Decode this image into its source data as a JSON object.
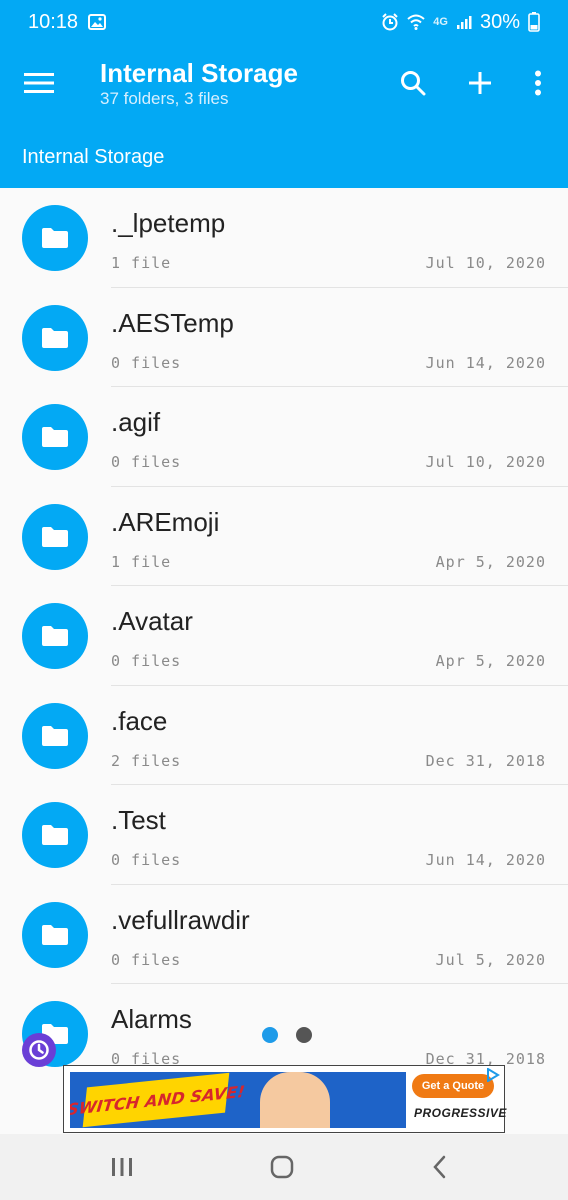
{
  "status_bar": {
    "time": "10:18",
    "network": "4G",
    "battery": "30%",
    "icons": [
      "image-icon",
      "alarm-icon",
      "wifi-icon",
      "signal-icon",
      "battery-icon"
    ]
  },
  "app_bar": {
    "title": "Internal Storage",
    "subtitle": "37 folders, 3 files",
    "actions": [
      "search-icon",
      "add-icon",
      "more-icon"
    ]
  },
  "breadcrumb": {
    "label": "Internal Storage"
  },
  "folders": [
    {
      "name": "._lpetemp",
      "count": "1 file",
      "date": "Jul 10, 2020"
    },
    {
      "name": ".AESTemp",
      "count": "0 files",
      "date": "Jun 14, 2020"
    },
    {
      "name": ".agif",
      "count": "0 files",
      "date": "Jul 10, 2020"
    },
    {
      "name": ".AREmoji",
      "count": "1 file",
      "date": "Apr 5, 2020"
    },
    {
      "name": ".Avatar",
      "count": "0 files",
      "date": "Apr 5, 2020"
    },
    {
      "name": ".face",
      "count": "2 files",
      "date": "Dec 31, 2018"
    },
    {
      "name": ".Test",
      "count": "0 files",
      "date": "Jun 14, 2020"
    },
    {
      "name": ".vefullrawdir",
      "count": "0 files",
      "date": "Jul 5, 2020"
    },
    {
      "name": "Alarms",
      "count": "0 files",
      "date": "Dec 31, 2018"
    }
  ],
  "ad": {
    "headline": "SWITCH AND SAVE!",
    "cta": "Get a Quote",
    "brand": "PROGRESSIVE"
  },
  "colors": {
    "primary": "#03a9f4",
    "dot_active": "#1e9be9",
    "dot_inactive": "#555555",
    "badge": "#6a3fd6"
  }
}
